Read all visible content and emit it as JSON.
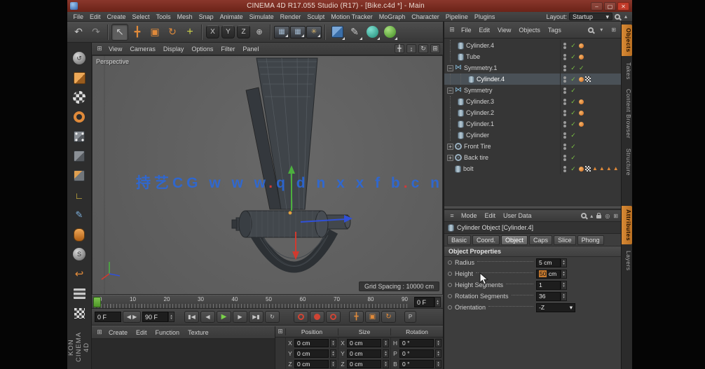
{
  "titlebar": {
    "title": "CINEMA 4D R17.055 Studio (R17) - [Bike.c4d *] - Main",
    "minimize": "–",
    "maximize": "▢",
    "close": "✕"
  },
  "menubar": {
    "items": [
      "File",
      "Edit",
      "Create",
      "Select",
      "Tools",
      "Mesh",
      "Snap",
      "Animate",
      "Simulate",
      "Render",
      "Sculpt",
      "Motion Tracker",
      "MoGraph",
      "Character",
      "Pipeline",
      "Plugins"
    ],
    "layout_label": "Layout:",
    "layout_value": "Startup",
    "dropdown": "▾",
    "up_icon": "▴"
  },
  "toolbar": {
    "undo": "↶",
    "redo": "↷",
    "select": "↖",
    "move": "╋",
    "scale": "▣",
    "rotate": "↻",
    "last_tool": "+",
    "axis_x": "X",
    "axis_y": "Y",
    "axis_z": "Z",
    "coords": "⊕",
    "render_view": "▦",
    "render_picture": "▦",
    "render_settings": "✳",
    "pen": "✎"
  },
  "palette": {
    "editable": "↺",
    "axis": "∟",
    "pen": "✎",
    "s": "S",
    "arrow": "↩"
  },
  "viewport": {
    "menu": [
      "View",
      "Cameras",
      "Display",
      "Options",
      "Filter",
      "Panel"
    ],
    "label": "Perspective",
    "grid_spacing": "Grid Spacing : 10000 cm",
    "panel_icon": "⊞",
    "pan_icon": "╋",
    "dolly_icon": "↕",
    "orbit_icon": "↻",
    "toggle_icon": "⊞"
  },
  "watermark": {
    "p1": "持艺CG",
    "p2": "w w w",
    "d1": ".",
    "p3": "q d n x x f b",
    "d2": ".",
    "p4": "c n"
  },
  "timeline": {
    "ticks": [
      "0",
      "10",
      "20",
      "30",
      "40",
      "50",
      "60",
      "70",
      "80",
      "90"
    ],
    "frame_field": "0 F",
    "start_field": "0 F",
    "end_field": "90 F",
    "to_start": "▮◀",
    "prev": "◀",
    "play": "▶",
    "next": "▶",
    "to_end": "▶▮",
    "loop": "↻",
    "key_pos": "╋",
    "key_scale": "▣",
    "key_rot": "↻",
    "key_param": "P",
    "spin_up": "▴",
    "spin_down": "▾"
  },
  "bottom": {
    "menu": [
      "Create",
      "Edit",
      "Function",
      "Texture"
    ],
    "panel_icon": "⊞",
    "coord_icon": "⊞",
    "headers": [
      "Position",
      "Size",
      "Rotation"
    ],
    "rows": [
      {
        "pa": "X",
        "pv": "0 cm",
        "sa": "X",
        "sv": "0 cm",
        "ra": "H",
        "rv": "0 °"
      },
      {
        "pa": "Y",
        "pv": "0 cm",
        "sa": "Y",
        "sv": "0 cm",
        "ra": "P",
        "rv": "0 °"
      },
      {
        "pa": "Z",
        "pv": "0 cm",
        "sa": "Z",
        "sv": "0 cm",
        "ra": "B",
        "rv": "0 °"
      }
    ]
  },
  "object_manager": {
    "menu": [
      "File",
      "Edit",
      "View",
      "Objects",
      "Tags"
    ],
    "panel_icon": "⊞",
    "dropdown": "▾",
    "grid_icon": "⊞",
    "expand_open": "−",
    "expand_closed": "+",
    "check": "✓",
    "tag_triangle": "▲",
    "rows": [
      {
        "name": "Cylinder.4"
      },
      {
        "name": "Tube"
      },
      {
        "name": "Symmetry.1"
      },
      {
        "name": "Cylinder.4"
      },
      {
        "name": "Symmetry"
      },
      {
        "name": "Cylinder.3"
      },
      {
        "name": "Cylinder.2"
      },
      {
        "name": "Cylinder.1"
      },
      {
        "name": "Cylinder"
      },
      {
        "name": "Front Tire"
      },
      {
        "name": "Back tire"
      },
      {
        "name": "bolt"
      }
    ]
  },
  "attributes": {
    "menu": [
      "Mode",
      "Edit",
      "User Data"
    ],
    "panel_icon": "≡",
    "up_icon": "▴",
    "target_icon": "◎",
    "grid_icon": "⊞",
    "object_title": "Cylinder Object [Cylinder.4]",
    "tabs": [
      "Basic",
      "Coord.",
      "Object",
      "Caps",
      "Slice",
      "Phong"
    ],
    "section": "Object Properties",
    "radius_label": "Radius",
    "radius_value": "5 cm",
    "height_label": "Height",
    "height_value": "50",
    "height_unit": "cm",
    "hseg_label": "Height Segments",
    "hseg_value": "1",
    "rseg_label": "Rotation Segments",
    "rseg_value": "36",
    "orient_label": "Orientation",
    "orient_value": "-Z",
    "spin_up": "▴",
    "spin_down": "▾",
    "dropdown": "▾"
  },
  "side_tabs": {
    "top": [
      "Objects",
      "Takes",
      "Content Browser",
      "Structure"
    ],
    "bottom": [
      "Attributes",
      "Layers"
    ]
  },
  "logo": "KON CINEMA 4D"
}
